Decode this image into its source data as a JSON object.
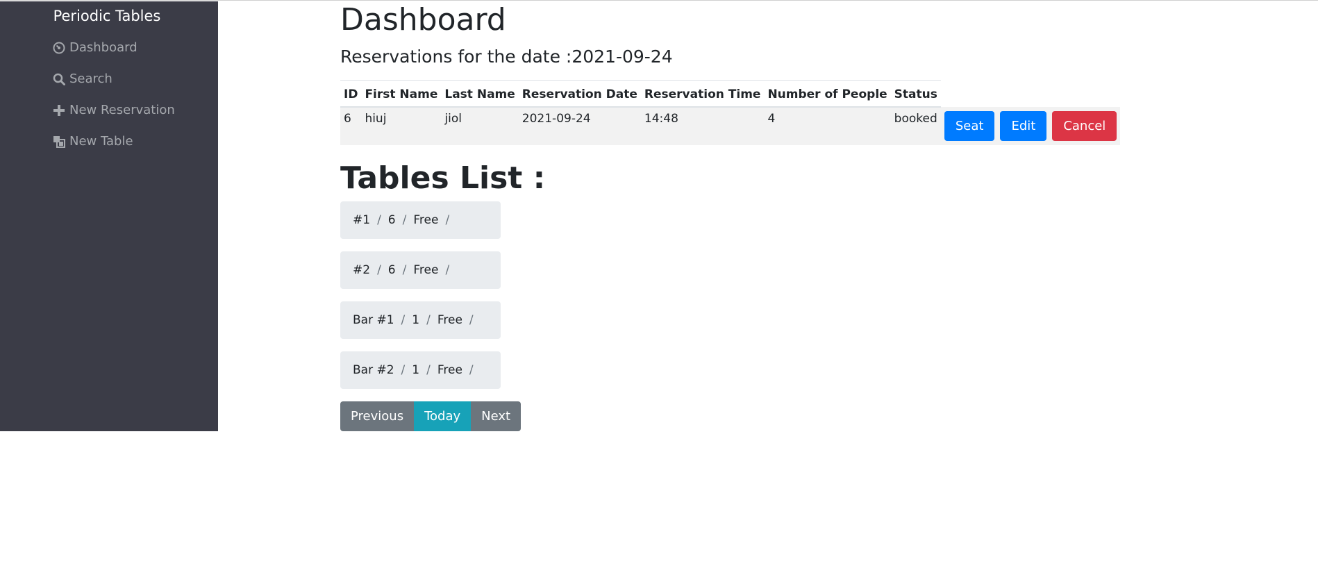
{
  "sidebar": {
    "brand": "Periodic Tables",
    "items": [
      {
        "label": "Dashboard",
        "icon": "dashboard-icon"
      },
      {
        "label": "Search",
        "icon": "search-icon"
      },
      {
        "label": "New Reservation",
        "icon": "plus-icon"
      },
      {
        "label": "New Table",
        "icon": "layers-icon"
      }
    ]
  },
  "main": {
    "title": "Dashboard",
    "subtitle": "Reservations for the date :2021-09-24",
    "table": {
      "headers": [
        "ID",
        "First Name",
        "Last Name",
        "Reservation Date",
        "Reservation Time",
        "Number of People",
        "Status"
      ],
      "rows": [
        {
          "id": "6",
          "first_name": "hiuj",
          "last_name": "jiol",
          "date": "2021-09-24",
          "time": "14:48",
          "people": "4",
          "status": "booked",
          "seat_label": "Seat",
          "edit_label": "Edit",
          "cancel_label": "Cancel"
        }
      ]
    },
    "tables_title": "Tables List :",
    "tables": [
      {
        "name": "#1",
        "capacity": "6",
        "status": "Free"
      },
      {
        "name": "#2",
        "capacity": "6",
        "status": "Free"
      },
      {
        "name": "Bar #1",
        "capacity": "1",
        "status": "Free"
      },
      {
        "name": "Bar #2",
        "capacity": "1",
        "status": "Free"
      }
    ],
    "nav": {
      "previous": "Previous",
      "today": "Today",
      "next": "Next"
    }
  },
  "colors": {
    "sidebar_bg": "#3b3c47",
    "primary": "#007bff",
    "danger": "#dc3545",
    "info": "#17a2b8",
    "secondary": "#6c757d"
  }
}
